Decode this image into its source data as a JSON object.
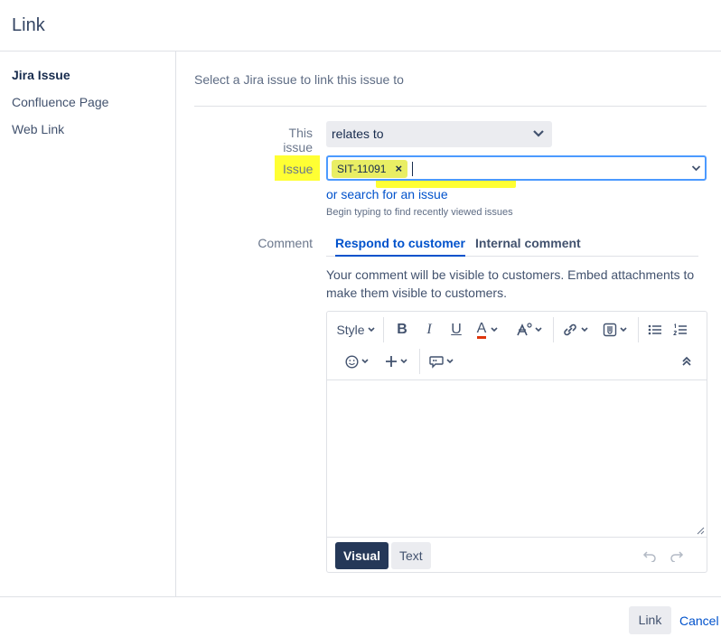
{
  "dialog": {
    "title": "Link"
  },
  "sidebar": {
    "items": [
      {
        "label": "Jira Issue",
        "active": true
      },
      {
        "label": "Confluence Page",
        "active": false
      },
      {
        "label": "Web Link",
        "active": false
      }
    ]
  },
  "main": {
    "intro": "Select a Jira issue to link this issue to",
    "this_issue": {
      "label": "This issue",
      "value": "relates to",
      "icon": "chevron-down-icon"
    },
    "issue": {
      "label": "Issue",
      "tag": "SIT-11091",
      "remove_symbol": "×",
      "search_link": "or search for an issue",
      "help": "Begin typing to find recently viewed issues"
    },
    "comment": {
      "label": "Comment",
      "tabs": [
        {
          "label": "Respond to customer",
          "active": true
        },
        {
          "label": "Internal comment",
          "active": false
        }
      ],
      "note": "Your comment will be visible to customers. Embed attachments to make them visible to customers.",
      "toolbar": {
        "style_label": "Style",
        "bold": "B",
        "italic": "I",
        "underline": "U",
        "text_color": "A",
        "icons": [
          "text-color-icon",
          "text-effects-icon",
          "link-icon",
          "attachment-icon",
          "bullet-list-icon",
          "numbered-list-icon",
          "emoji-icon",
          "insert-more-icon",
          "quote-icon",
          "collapse-toolbar-icon"
        ]
      },
      "modes": [
        {
          "label": "Visual",
          "active": true
        },
        {
          "label": "Text",
          "active": false
        }
      ]
    }
  },
  "footer": {
    "link_label": "Link",
    "cancel_label": "Cancel"
  },
  "colors": {
    "accent": "#0052cc",
    "highlight": "#ffff33",
    "dark_button": "#253858"
  }
}
